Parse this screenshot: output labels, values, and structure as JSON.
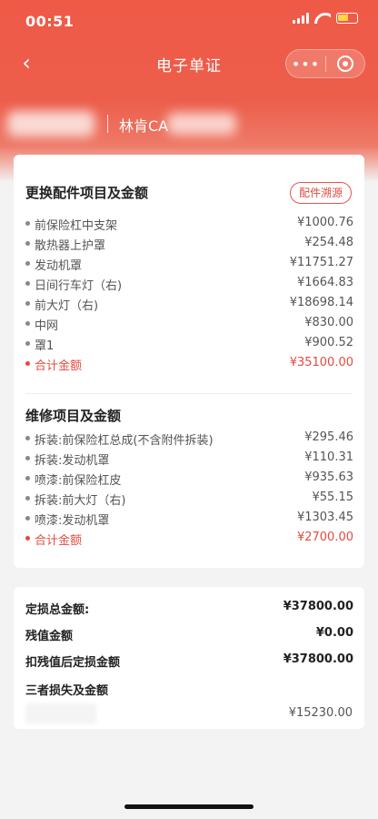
{
  "status_bar": {
    "time": "00:51"
  },
  "nav": {
    "back": "‹",
    "title": "电子单证",
    "more": "•••"
  },
  "vehicle": {
    "owner": "林肯CA"
  },
  "parts": {
    "title": "更换配件项目及金额",
    "trace_button": "配件溯源",
    "items": [
      {
        "name": "前保险杠中支架",
        "amount": "¥1000.76"
      },
      {
        "name": "散热器上护罩",
        "amount": "¥254.48"
      },
      {
        "name": "发动机罩",
        "amount": "¥11751.27"
      },
      {
        "name": "日间行车灯（右)",
        "amount": "¥1664.83"
      },
      {
        "name": "前大灯（右)",
        "amount": "¥18698.14"
      },
      {
        "name": "中网",
        "amount": "¥830.00"
      },
      {
        "name": "罩1",
        "amount": "¥900.52"
      }
    ],
    "total": {
      "name": "合计金额",
      "amount": "¥35100.00"
    }
  },
  "repair": {
    "title": "维修项目及金额",
    "items": [
      {
        "name": "拆装:前保险杠总成(不含附件拆装)",
        "amount": "¥295.46"
      },
      {
        "name": "拆装:发动机罩",
        "amount": "¥110.31"
      },
      {
        "name": "喷漆:前保险杠皮",
        "amount": "¥935.63"
      },
      {
        "name": "拆装:前大灯（右)",
        "amount": "¥55.15"
      },
      {
        "name": "喷漆:发动机罩",
        "amount": "¥1303.45"
      }
    ],
    "total": {
      "name": "合计金额",
      "amount": "¥2700.00"
    }
  },
  "summary": {
    "rows": [
      {
        "label": "定损总金额:",
        "value": "¥37800.00"
      },
      {
        "label": "残值金额",
        "value": "¥0.00"
      },
      {
        "label": "扣残值后定损金额",
        "value": "¥37800.00"
      }
    ],
    "third_party_title": "三者损失及金额",
    "third_party_amount": "¥15230.00"
  },
  "colors": {
    "brand": "#ec5e4b",
    "accent_red": "#e24b3f"
  }
}
